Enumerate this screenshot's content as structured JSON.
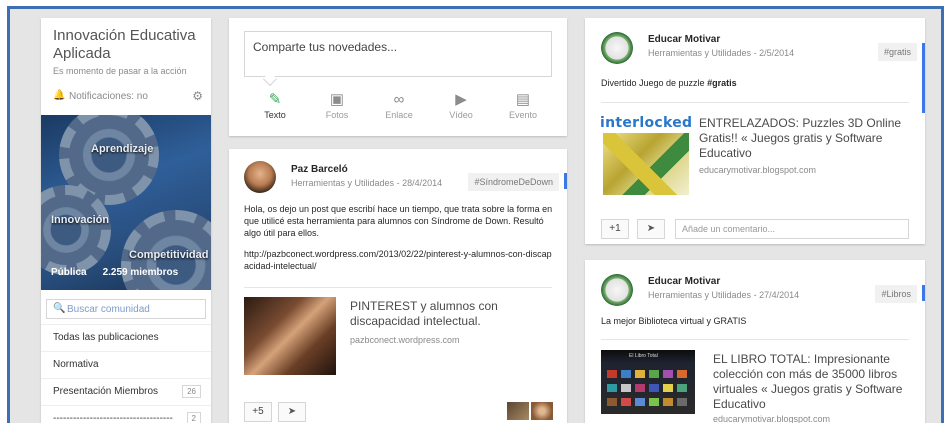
{
  "colors": {
    "frame_border": "#3d6fb5",
    "background": "#e5e5e5",
    "accent_blue": "#3b78e7",
    "active_green": "#3aa757"
  },
  "community": {
    "title": "Innovación Educativa Aplicada",
    "tagline": "Es momento de pasar a la acción",
    "notifications": "Notificaciones: no",
    "icons": {
      "bell": "bell-icon",
      "settings": "gear-icon"
    },
    "cover_words": [
      "Aprendizaje",
      "Innovación",
      "Competitividad"
    ],
    "visibility": "Pública",
    "members": "2.259 miembros",
    "search_placeholder": "Buscar comunidad",
    "categories": [
      {
        "label": "Todas las publicaciones",
        "count": ""
      },
      {
        "label": "Normativa",
        "count": ""
      },
      {
        "label": "Presentación Miembros",
        "count": "26"
      },
      {
        "label": "------------------------------------",
        "count": "2"
      }
    ]
  },
  "share": {
    "placeholder": "Comparte tus novedades...",
    "options": [
      {
        "label": "Texto",
        "icon": "pencil-icon",
        "active": true
      },
      {
        "label": "Fotos",
        "icon": "camera-icon",
        "active": false
      },
      {
        "label": "Enlace",
        "icon": "link-icon",
        "active": false
      },
      {
        "label": "Vídeo",
        "icon": "video-icon",
        "active": false
      },
      {
        "label": "Evento",
        "icon": "calendar-icon",
        "active": false
      }
    ]
  },
  "posts": {
    "paz": {
      "author": "Paz Barceló",
      "category": "Herramientas y Utilidades",
      "date": "28/4/2014",
      "tag": "#SíndromeDeDown",
      "body": "Hola, os dejo un post que escribí hace un tiempo, que trata sobre la forma en que utilicé esta herramienta para alumnos con Síndrome de Down. Resultó algo útil para ellos.",
      "url": "http://pazbconect.wordpress.com/2013/02/22/pinterest-y-alumnos-con-discapacidad-intelectual/",
      "link_title": "PINTEREST y alumnos con discapacidad intelectual.",
      "link_domain": "pazbconect.wordpress.com",
      "plus": "+5"
    },
    "educar1": {
      "author": "Educar Motivar",
      "category": "Herramientas y Utilidades",
      "date": "2/5/2014",
      "tag": "#gratis",
      "body_prefix": "Divertido Juego de puzzle ",
      "body_tag": "#gratis",
      "logo_text": "interlocked",
      "link_title": "ENTRELAZADOS: Puzzles 3D Online Gratis!! « Juegos gratis y Software Educativo",
      "link_domain": "educarymotivar.blogspot.com",
      "plus": "+1",
      "comment_placeholder": "Añade un comentario..."
    },
    "educar2": {
      "author": "Educar Motivar",
      "category": "Herramientas y Utilidades",
      "date": "27/4/2014",
      "tag": "#Libros",
      "body": "La mejor Biblioteca virtual y GRATIS",
      "image_caption": "El Libro Total",
      "link_title": "EL LIBRO TOTAL: Impresionante colección con más de 35000 libros virtuales « Juegos gratis y Software Educativo",
      "link_domain": "educarymotivar.blogspot.com"
    }
  },
  "separator": "-"
}
